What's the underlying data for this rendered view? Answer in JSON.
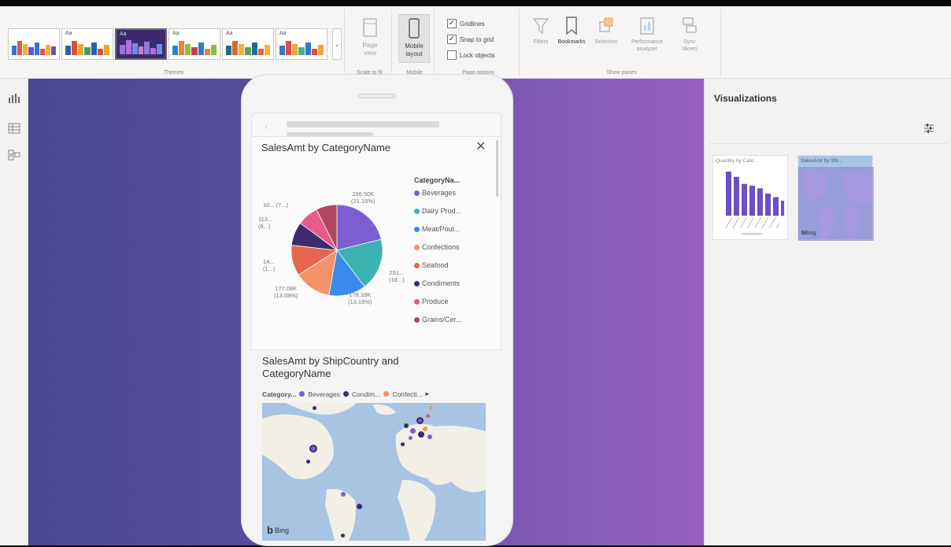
{
  "ribbon": {
    "groups": {
      "themes": "Themes",
      "scale": "Scale to fit",
      "mobile": "Mobile",
      "page_options": "Page options",
      "show_panes": "Show panes"
    },
    "theme_aa": "Aa",
    "page_view": [
      "Page",
      "view"
    ],
    "mobile_layout": [
      "Mobile",
      "layout"
    ],
    "checkboxes": [
      {
        "label": "Gridlines",
        "checked": true
      },
      {
        "label": "Snap to grid",
        "checked": true
      },
      {
        "label": "Lock objects",
        "checked": false
      }
    ],
    "panes": {
      "filters": "Filters",
      "bookmarks": "Bookmarks",
      "selection": "Selection",
      "performance": [
        "Performance",
        "analyzer"
      ],
      "sync": [
        "Sync",
        "slicers"
      ]
    }
  },
  "visual1": {
    "title": "SalesAmt by CategoryName",
    "close": "✕",
    "legend_title": "CategoryNa...",
    "legend": [
      {
        "label": "Beverages",
        "color": "#7b5fd0"
      },
      {
        "label": "Dairy Prod...",
        "color": "#3cb3b2"
      },
      {
        "label": "Meat/Poul...",
        "color": "#3a8bea"
      },
      {
        "label": "Confections",
        "color": "#f2936b"
      },
      {
        "label": "Seafood",
        "color": "#e6664f"
      },
      {
        "label": "Condiments",
        "color": "#3b2d6b"
      },
      {
        "label": "Produce",
        "color": "#e75b88"
      },
      {
        "label": "Grains/Cer...",
        "color": "#b4455f"
      }
    ],
    "labels": {
      "beverages": [
        "286.50K",
        "(21.15%)"
      ],
      "dairy": [
        "251...",
        "(18...)"
      ],
      "meat": [
        "178.18K",
        "(13.16%)"
      ],
      "confections": [
        "177.08K",
        "(13.08%)"
      ],
      "seafood": [
        "14...",
        "(1...)"
      ],
      "condiments": [
        "113...",
        "(8...)"
      ],
      "grains": [
        "10... (7...)"
      ]
    },
    "slices": [
      {
        "name": "Beverages",
        "percent": 21.15,
        "color": "#7b5fd0"
      },
      {
        "name": "Dairy Products",
        "percent": 18.5,
        "color": "#3cb3b2"
      },
      {
        "name": "Meat/Poultry",
        "percent": 13.16,
        "color": "#3a8bea"
      },
      {
        "name": "Confections",
        "percent": 13.08,
        "color": "#f2936b"
      },
      {
        "name": "Seafood",
        "percent": 10.9,
        "color": "#e6664f"
      },
      {
        "name": "Condiments",
        "percent": 8.36,
        "color": "#3b2d6b"
      },
      {
        "name": "Produce",
        "percent": 7.45,
        "color": "#e75b88"
      },
      {
        "name": "Grains/Cereals",
        "percent": 7.4,
        "color": "#b4455f"
      }
    ]
  },
  "visual2": {
    "title_line1": "SalesAmt by ShipCountry and",
    "title_line2": "CategoryName",
    "legend_title": "Category...",
    "legend": [
      {
        "label": "Beverages",
        "color": "#7b5fd0"
      },
      {
        "label": "Condim...",
        "color": "#3b2d6b"
      },
      {
        "label": "Confecti...",
        "color": "#f2936b"
      }
    ],
    "more": "▸",
    "bing": "Bing"
  },
  "visualizations": {
    "title": "Visualizations",
    "thumb1_title": "Quantity by Cate...",
    "thumb2_title": "SalesAmt by Shi...",
    "thumb1_bars": [
      1.0,
      0.88,
      0.72,
      0.68,
      0.62,
      0.5,
      0.42,
      0.34
    ],
    "bar_color": "#6c4fc2"
  }
}
